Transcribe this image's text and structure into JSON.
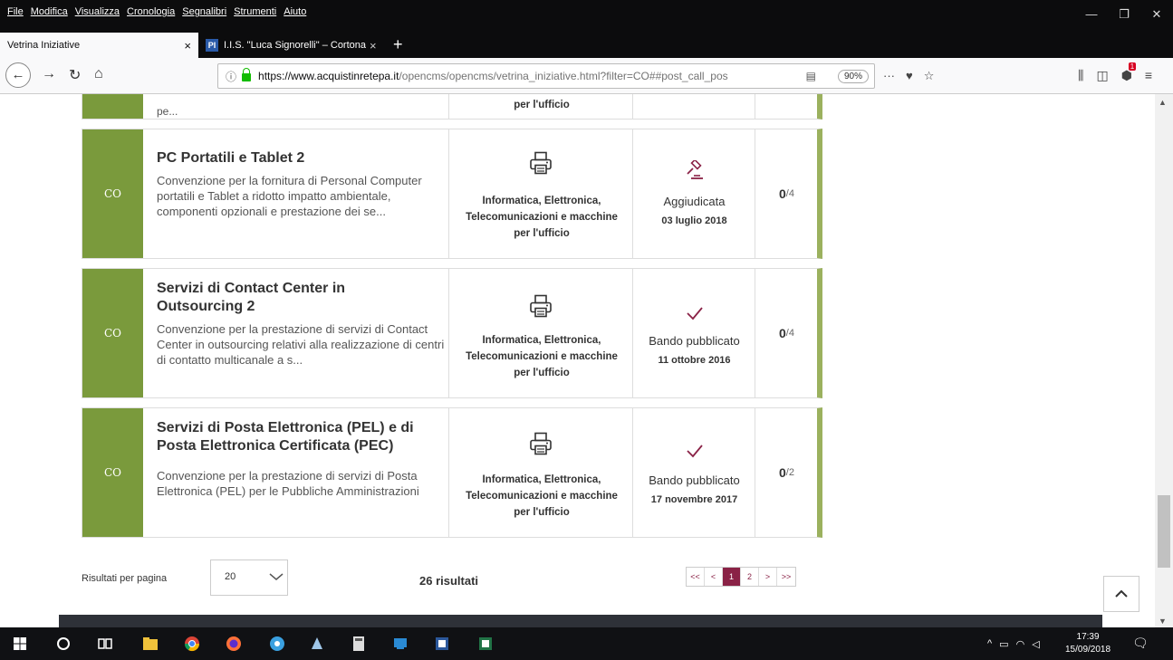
{
  "menubar": {
    "items": [
      "File",
      "Modifica",
      "Visualizza",
      "Cronologia",
      "Segnalibri",
      "Strumenti",
      "Aiuto"
    ]
  },
  "tabs": [
    {
      "label": "Vetrina Iniziative",
      "close": "×"
    },
    {
      "label": "I.I.S. \"Luca Signorelli\" – Cortona",
      "close": "×",
      "favicon": "PI"
    }
  ],
  "urlbar": {
    "host": "https://www.acquistinretepa.it",
    "path": "/opencms/opencms/vetrina_iniziative.html?filter=CO##post_call_pos",
    "zoom": "90%"
  },
  "page_actions": {
    "more": "···"
  },
  "notification_count": "1",
  "cards": [
    {
      "type": "CO",
      "title": "PC Portatili e Tablet 2",
      "description": "Convenzione per la fornitura di Personal Computer portatili e Tablet a ridotto impatto ambientale, componenti opzionali e prestazione dei se...",
      "category": [
        "Informatica, Elettronica,",
        "Telecomunicazioni e macchine",
        "per l'ufficio"
      ],
      "status": "Aggiudicata",
      "status_icon": "gavel-icon",
      "date": "03 luglio 2018",
      "count": "0",
      "count_total": "/4"
    },
    {
      "type": "CO",
      "title": "Servizi di Contact Center in Outsourcing 2",
      "description": "Convenzione per la prestazione di servizi di Contact Center in outsourcing relativi alla realizzazione di centri di contatto multicanale a s...",
      "category": [
        "Informatica, Elettronica,",
        "Telecomunicazioni e macchine",
        "per l'ufficio"
      ],
      "status": "Bando pubblicato",
      "status_icon": "check-icon",
      "date": "11 ottobre 2016",
      "count": "0",
      "count_total": "/4"
    },
    {
      "type": "CO",
      "title": "Servizi di Posta Elettronica (PEL) e di Posta Elettronica Certificata (PEC)",
      "description": "Convenzione per la prestazione di servizi di Posta Elettronica (PEL) per le Pubbliche Amministrazioni",
      "category": [
        "Informatica, Elettronica,",
        "Telecomunicazioni e macchine",
        "per l'ufficio"
      ],
      "status": "Bando pubblicato",
      "status_icon": "check-icon",
      "date": "17 novembre 2017",
      "count": "0",
      "count_total": "/2"
    }
  ],
  "prev_card": {
    "desc_tail": "pe...",
    "cat_tail": "per l'ufficio"
  },
  "results": {
    "per_page_label": "Risultati per pagina",
    "per_page_value": "20",
    "total": "26 risultati",
    "pager": [
      "<<",
      "<",
      "1",
      "2",
      ">",
      ">>"
    ]
  },
  "colors": {
    "type_green": "#7a9a3c",
    "accent_border": "#9bb15e",
    "brand_magenta": "#8a2246"
  },
  "taskbar": {
    "time": "17:39",
    "date": "15/09/2018"
  }
}
